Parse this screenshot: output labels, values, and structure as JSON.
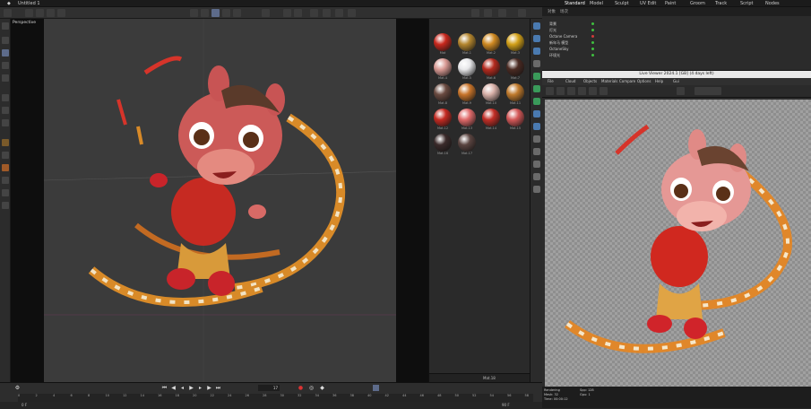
{
  "app": {
    "file_tab": "Untitled 1"
  },
  "top_tabs": [
    "Standard",
    "Model",
    "Sculpt",
    "UV Edit",
    "Paint",
    "Groom",
    "Track",
    "Script",
    "Nodes"
  ],
  "viewport": {
    "label": "Perspective"
  },
  "materials": [
    {
      "color": "#c8281d",
      "name": "Mat"
    },
    {
      "color": "#b4862e",
      "name": "Mat.1"
    },
    {
      "color": "#d08a22",
      "name": "Mat.2"
    },
    {
      "color": "#d2a018",
      "name": "Mat.3"
    },
    {
      "color": "#d99a94",
      "name": "Mat.4"
    },
    {
      "color": "#e8e8ea",
      "name": "Mat.5"
    },
    {
      "color": "#b42a1e",
      "name": "Mat.6"
    },
    {
      "color": "#4a2a22",
      "name": "Mat.7"
    },
    {
      "color": "#6a4a40",
      "name": "Mat.8"
    },
    {
      "color": "#c8742a",
      "name": "Mat.9"
    },
    {
      "color": "#d8b0a8",
      "name": "Mat.10"
    },
    {
      "color": "#c07a2c",
      "name": "Mat.11"
    },
    {
      "color": "#c42a22",
      "name": "Mat.12"
    },
    {
      "color": "#e06a6a",
      "name": "Mat.13"
    },
    {
      "color": "#c22e26",
      "name": "Mat.14"
    },
    {
      "color": "#d45858",
      "name": "Mat.15"
    },
    {
      "color": "#3a2a2a",
      "name": "Mat.16"
    },
    {
      "color": "#5a4440",
      "name": "Mat.17"
    }
  ],
  "material_footer": "Mat.18",
  "timeline": {
    "current_frame": "17",
    "ticks": [
      "0",
      "2",
      "4",
      "6",
      "8",
      "10",
      "12",
      "14",
      "16",
      "18",
      "20",
      "22",
      "24",
      "26",
      "28",
      "30",
      "32",
      "34",
      "36",
      "38",
      "40",
      "42",
      "44",
      "46",
      "48",
      "50",
      "52",
      "54",
      "56",
      "58"
    ],
    "start": "0 F",
    "end": "90 F"
  },
  "right_tabs": [
    "对象",
    "场次"
  ],
  "objects": [
    {
      "name": "背景",
      "dot": "#3fbf3f"
    },
    {
      "name": "灯光",
      "dot": "#3fbf3f"
    },
    {
      "name": "Octane Camera",
      "dot": "#d03a3a"
    },
    {
      "name": "新年马 模型",
      "dot": "#3fbf3f"
    },
    {
      "name": "OctaneSky",
      "dot": "#3fbf3f"
    },
    {
      "name": "环境光",
      "dot": "#3fbf3f"
    }
  ],
  "live_viewer": {
    "title": "Live Viewer 2024.1 [GB] (4 days left)",
    "menu": [
      "File",
      "Cloud",
      "Objects",
      "Materials",
      "Compare",
      "Options",
      "Help",
      "Gui"
    ],
    "status": [
      "Rendering",
      "Spp: 128",
      "Mesh: 32",
      "Gpu: 1",
      "Time: 00:00:12"
    ]
  },
  "colors": {
    "accent": "#5d6b8a",
    "bg": "#262626"
  }
}
